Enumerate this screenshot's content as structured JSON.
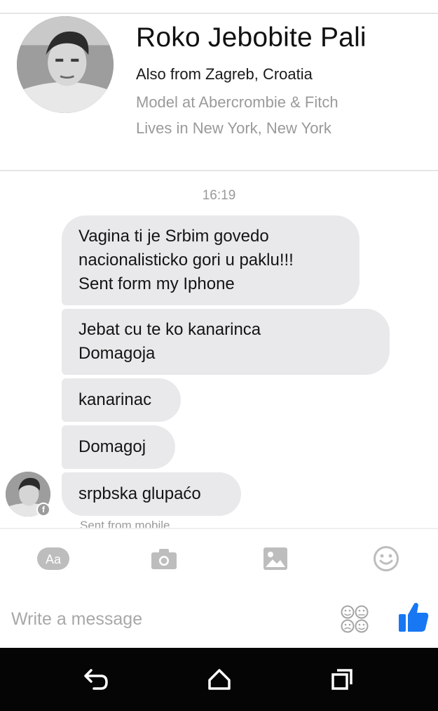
{
  "profile": {
    "name": "Roko Jebobite Pali",
    "from": "Also from Zagreb, Croatia",
    "work": "Model at Abercrombie & Fitch",
    "lives": "Lives in New York, New York"
  },
  "conversation": {
    "timestamp": "16:19",
    "messages": [
      {
        "lines": [
          "Vagina ti je Srbim govedo",
          "nacionalisticko gori u paklu!!!",
          "Sent form my Iphone"
        ]
      },
      {
        "lines": [
          "Jebat cu te ko kanarinca",
          "Domagoja"
        ]
      },
      {
        "lines": [
          "kanarinac"
        ]
      },
      {
        "lines": [
          "Domagoj"
        ]
      },
      {
        "lines": [
          "srpbska glupaćo"
        ]
      }
    ],
    "status_note": "Sent from mobile"
  },
  "toolbar": {
    "text_button": "Aa",
    "icons": [
      "text-format-icon",
      "camera-icon",
      "image-icon",
      "emoji-icon"
    ]
  },
  "composer": {
    "placeholder": "Write a message",
    "icons": [
      "sticker-icon",
      "thumbs-up-icon"
    ]
  },
  "navbar": {
    "icons": [
      "back-icon",
      "home-icon",
      "recent-apps-icon"
    ]
  },
  "colors": {
    "bubble": "#e9e9eb",
    "secondary_text": "#9a9a9a",
    "toolbar_icon": "#bdbdbd",
    "like_blue": "#1877f2",
    "navbar": "#050505"
  }
}
